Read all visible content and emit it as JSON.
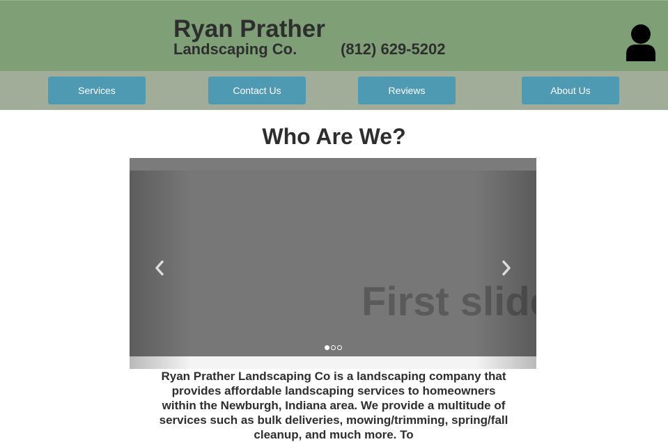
{
  "header": {
    "brand_name": "Ryan Prather",
    "brand_sub": "Landscaping Co.",
    "phone": "(812) 629-5202",
    "user_icon": "user-icon",
    "colors": {
      "header_bg": "#7f9f77",
      "text": "#2e2e2e"
    }
  },
  "nav": {
    "items": [
      {
        "label": "Services"
      },
      {
        "label": "Contact Us"
      },
      {
        "label": "Reviews"
      },
      {
        "label": "About Us"
      }
    ],
    "colors": {
      "bar_bg": "#a1ad99",
      "button_bg": "#4f9ab3",
      "button_text": "#ffffff"
    }
  },
  "main": {
    "title": "Who Are We?",
    "carousel": {
      "slide_text": "First slide",
      "active_index": 0,
      "slide_count": 3,
      "prev_icon": "chevron-left-icon",
      "next_icon": "chevron-right-icon",
      "colors": {
        "slide_bg": "#777777",
        "slide_text": "#5a5a5a"
      }
    },
    "about_text": "Ryan Prather Landscaping Co is a landscaping company that provides affordable landscaping services to homeowners within the Newburgh, Indiana area. We provide a multitude of services such as bulk deliveries, mowing/trimming, spring/fall cleanup, and much more. To"
  }
}
